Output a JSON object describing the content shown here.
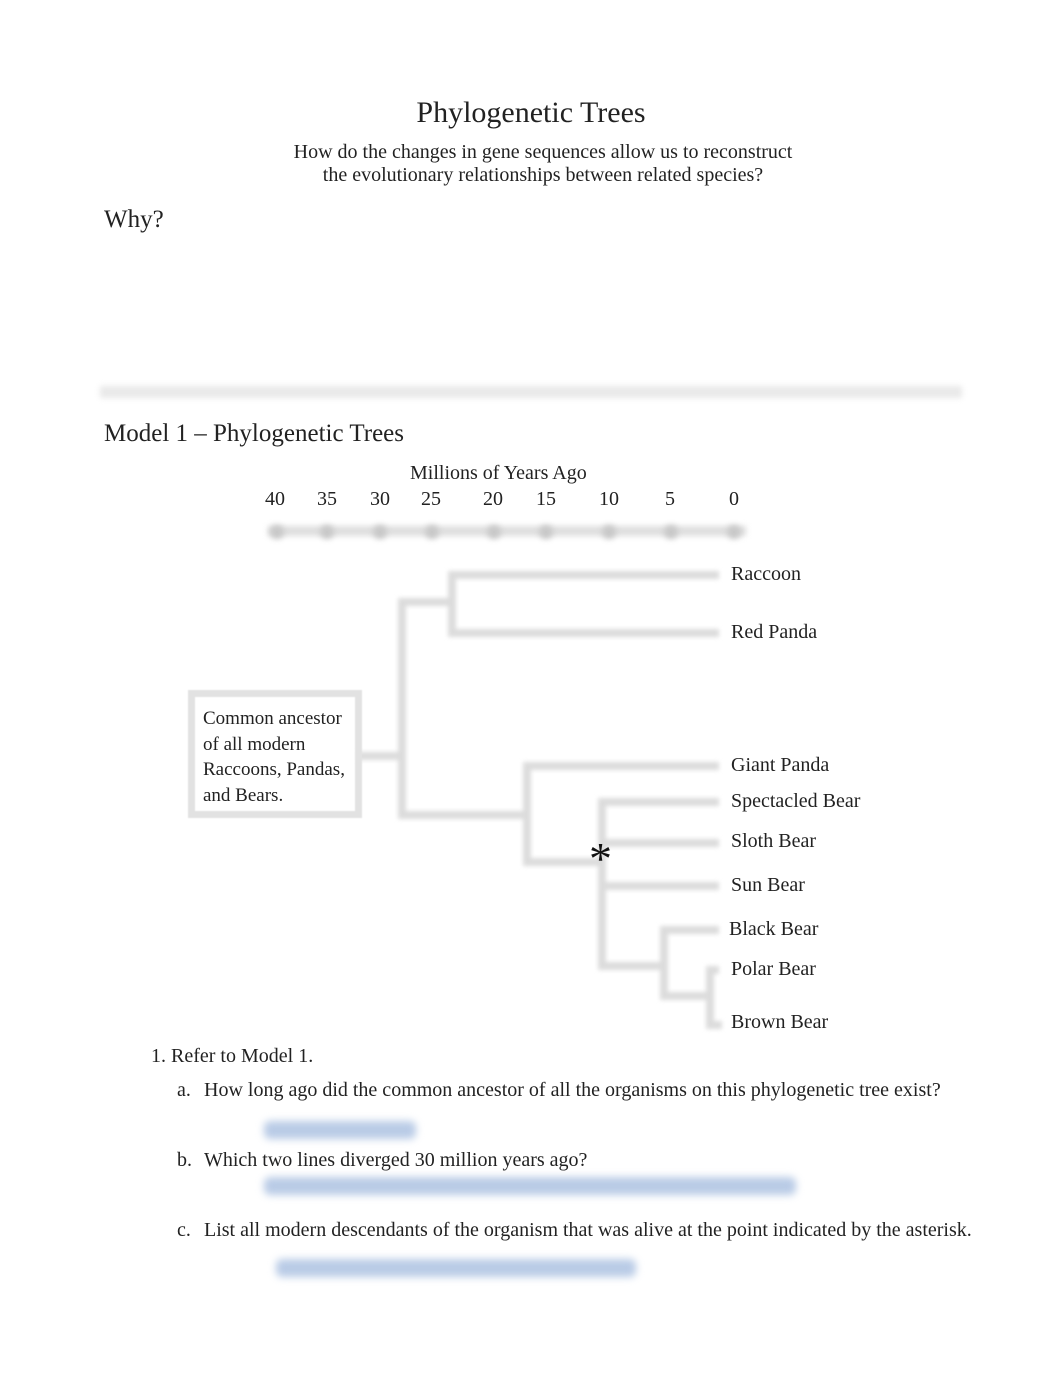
{
  "document": {
    "title": "Phylogenetic Trees",
    "subtitle_line1": "How do the changes in gene sequences allow us to reconstruct",
    "subtitle_line2": "the evolutionary relationships between related species?",
    "why_heading": "Why?",
    "model_heading": "Model 1 – Phylogenetic Trees"
  },
  "tree": {
    "axis_title": "Millions of Years Ago",
    "ticks": [
      "40",
      "35",
      "30",
      "25",
      "20",
      "15",
      "10",
      "5",
      "0"
    ],
    "ancestor_label_lines": [
      "Common ancestor",
      "of all modern",
      "Raccoons, Pandas,",
      "and Bears."
    ],
    "asterisk": "*",
    "taxa": [
      "Raccoon",
      "Red Panda",
      "Giant Panda",
      "Spectacled Bear",
      "Sloth Bear",
      "Sun Bear",
      "Black Bear",
      "Polar Bear",
      "Brown Bear"
    ]
  },
  "questions": {
    "q1_label": "1. Refer to Model 1.",
    "items": [
      {
        "letter": "a.",
        "text": "How long ago did the common ancestor of all the organisms on this phylogenetic tree exist?",
        "answer": "[redacted answer]"
      },
      {
        "letter": "b.",
        "text": "Which two lines diverged 30 million years ago?",
        "answer": "[redacted answer]"
      },
      {
        "letter": "c.",
        "text": "List all modern descendants of the organism that was alive at the point indicated by the asterisk.",
        "answer": "[redacted answer]"
      }
    ]
  }
}
